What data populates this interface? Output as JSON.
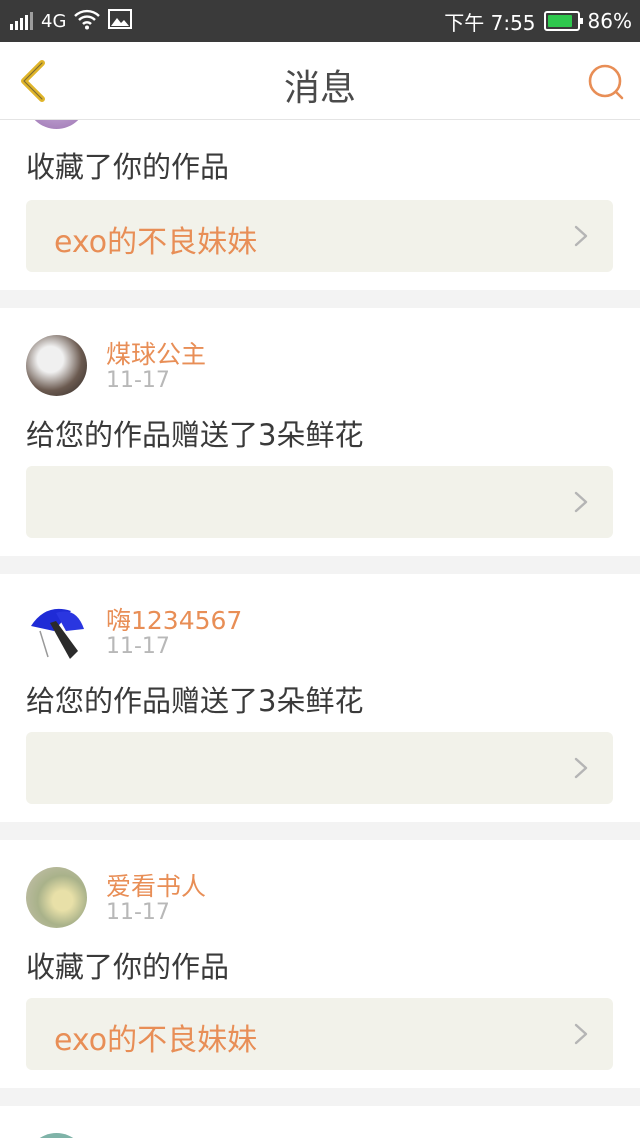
{
  "status_bar": {
    "signal_icon": "signal-bars-icon",
    "network": "4G",
    "wifi_icon": "wifi-icon",
    "image_icon": "gallery-icon",
    "time": "下午 7:55",
    "battery_percent": "86%",
    "battery_level": 0.86,
    "battery_color": "#2fc84e"
  },
  "nav": {
    "title": "消息",
    "back_icon": "back-chevron-icon",
    "search_icon": "search-icon"
  },
  "colors": {
    "accent": "#e88e56",
    "back_icon": "#e0b52a",
    "card_bg": "#ffffff",
    "link_bg": "#f2f2ea"
  },
  "messages": [
    {
      "user": "",
      "date": "",
      "text": "收藏了你的作品",
      "work_title": "exo的不良妹妹"
    },
    {
      "user": "煤球公主",
      "date": "11-17",
      "text": "给您的作品赠送了3朵鲜花",
      "work_title": ""
    },
    {
      "user": "嗨1234567",
      "date": "11-17",
      "text": "给您的作品赠送了3朵鲜花",
      "work_title": ""
    },
    {
      "user": "爱看书人",
      "date": "11-17",
      "text": "收藏了你的作品",
      "work_title": "exo的不良妹妹"
    }
  ]
}
